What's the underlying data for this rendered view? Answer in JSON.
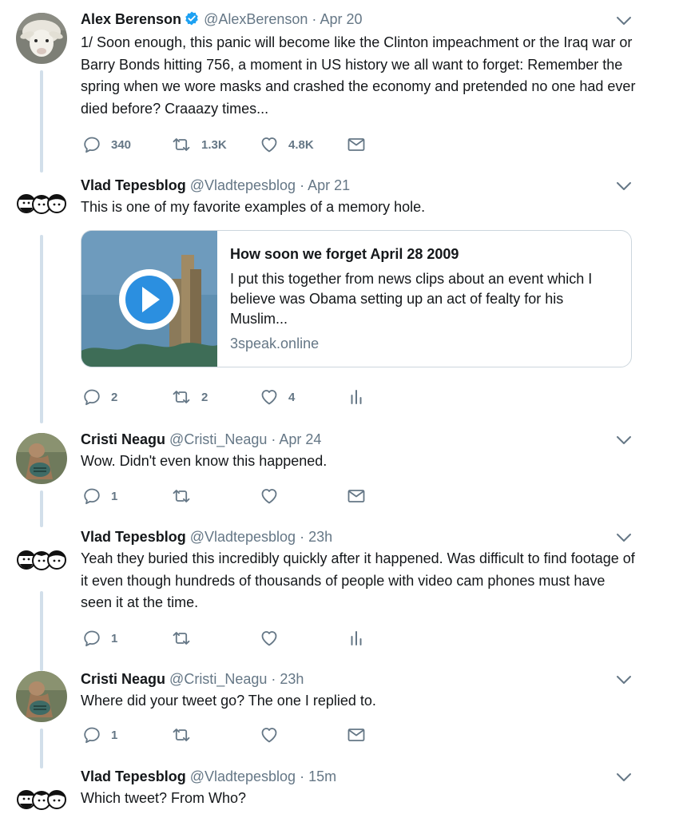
{
  "colors": {
    "text_primary": "#14171a",
    "text_secondary": "#657786",
    "verified_blue": "#1da1f2",
    "thread_line": "#d2dfea",
    "card_border": "#ccd6dd"
  },
  "tweets": [
    {
      "name": "Alex Berenson",
      "verified": true,
      "handle": "@AlexBerenson",
      "separator": "·",
      "time": "Apr 20",
      "text": "1/ Soon enough, this panic will become like the Clinton impeachment or the Iraq war or Barry Bonds hitting 756, a moment in US history we all want to forget: Remember the spring when we wore masks and crashed the economy and pretended no one had ever died before? Craaazy times...",
      "actions": {
        "reply": "340",
        "retweet": "1.3K",
        "like": "4.8K",
        "extra_icon": "envelope-icon"
      }
    },
    {
      "name": "Vlad Tepesblog",
      "handle": "@Vladtepesblog",
      "separator": "·",
      "time": "Apr 21",
      "text": "This is one of my favorite examples of a memory hole.",
      "card": {
        "title": "How soon we forget April 28 2009",
        "description": "I put this together from news clips about an event which I believe was Obama setting up an act of fealty for his Muslim...",
        "domain": "3speak.online",
        "media_icon": "play-icon"
      },
      "actions": {
        "reply": "2",
        "retweet": "2",
        "like": "4",
        "extra_icon": "analytics-icon"
      }
    },
    {
      "name": "Cristi Neagu",
      "handle": "@Cristi_Neagu",
      "separator": "·",
      "time": "Apr 24",
      "text": "Wow. Didn't even know this happened.",
      "actions": {
        "reply": "1",
        "retweet": "",
        "like": "",
        "extra_icon": "envelope-icon"
      }
    },
    {
      "name": "Vlad Tepesblog",
      "handle": "@Vladtepesblog",
      "separator": "·",
      "time": "23h",
      "text": "Yeah they buried this incredibly quickly after it happened. Was difficult to find footage of it even though hundreds of thousands of people with video cam phones must have seen it at the time.",
      "actions": {
        "reply": "1",
        "retweet": "",
        "like": "",
        "extra_icon": "analytics-icon"
      }
    },
    {
      "name": "Cristi Neagu",
      "handle": "@Cristi_Neagu",
      "separator": "·",
      "time": "23h",
      "text": "Where did your tweet go? The one I replied to.",
      "actions": {
        "reply": "1",
        "retweet": "",
        "like": "",
        "extra_icon": "envelope-icon"
      }
    },
    {
      "name": "Vlad Tepesblog",
      "handle": "@Vladtepesblog",
      "separator": "·",
      "time": "15m",
      "text": "Which tweet? From Who?"
    }
  ]
}
